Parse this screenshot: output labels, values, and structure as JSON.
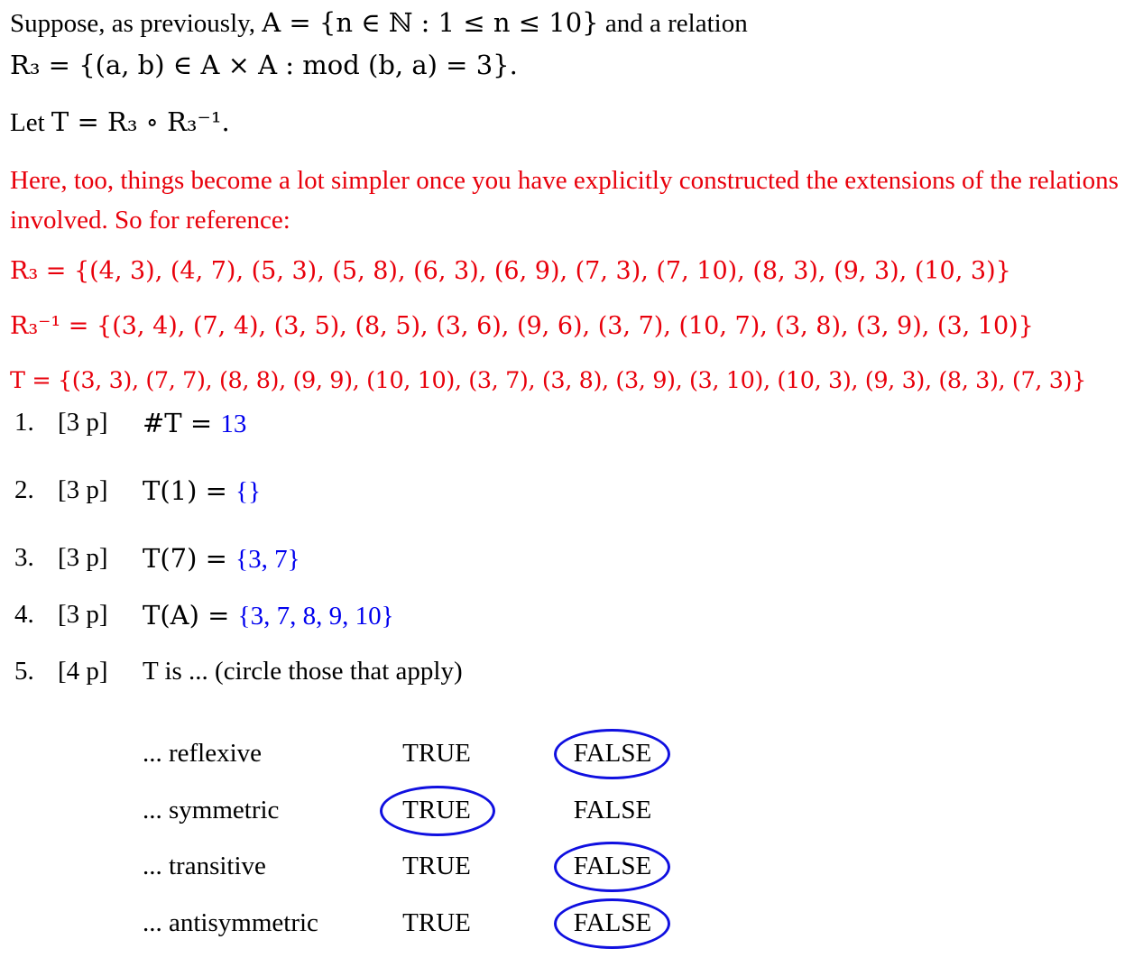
{
  "intro": {
    "line1_prefix": "Suppose, as previously, ",
    "line1_math": "A = {n ∈ ℕ : 1 ≤ n ≤ 10}",
    "line1_suffix": " and a relation",
    "line2_math": "R₃ = {(a, b) ∈ A × A :   mod (b, a) = 3}."
  },
  "let": {
    "prefix": "Let ",
    "math": "T = R₃ ∘ R₃⁻¹."
  },
  "note": "Here, too, things become a lot simpler once you have explicitly constructed the extensions of the relations involved. So for reference:",
  "reference": {
    "r3": "R₃ = {(4, 3), (4, 7), (5, 3), (5, 8), (6, 3), (6, 9), (7, 3), (7, 10), (8, 3), (9, 3), (10, 3)}",
    "r3inv": "R₃⁻¹ = {(3, 4), (7, 4), (3, 5), (8, 5), (3, 6), (9, 6), (3, 7), (10, 7), (3, 8), (3, 9), (3, 10)}",
    "t": "T = {(3, 3), (7, 7), (8, 8), (9, 9), (10, 10), (3, 7), (3, 8), (3, 9), (3, 10), (10, 3), (9, 3), (8, 3), (7, 3)}"
  },
  "questions": [
    {
      "num": "1.",
      "points": "[3 p]",
      "expr": "#T = ",
      "answer": "13"
    },
    {
      "num": "2.",
      "points": "[3 p]",
      "expr": "T(1) = ",
      "answer": "{}"
    },
    {
      "num": "3.",
      "points": "[3 p]",
      "expr": "T(7) = ",
      "answer": "{3, 7}"
    },
    {
      "num": "4.",
      "points": "[3 p]",
      "expr": "T(A) = ",
      "answer": "{3, 7, 8, 9, 10}"
    },
    {
      "num": "5.",
      "points": "[4 p]",
      "expr": "T is ...  (circle those that apply)",
      "answer": ""
    }
  ],
  "properties": [
    {
      "label": "... reflexive",
      "true_label": "TRUE",
      "false_label": "FALSE",
      "circled": "FALSE"
    },
    {
      "label": "... symmetric",
      "true_label": "TRUE",
      "false_label": "FALSE",
      "circled": "TRUE"
    },
    {
      "label": "... transitive",
      "true_label": "TRUE",
      "false_label": "FALSE",
      "circled": "FALSE"
    },
    {
      "label": "... antisymmetric",
      "true_label": "TRUE",
      "false_label": "FALSE",
      "circled": "FALSE"
    }
  ],
  "colors": {
    "annotation_red": "#e8000b",
    "answer_blue": "#0000ee",
    "circle_blue": "#1010e0"
  }
}
